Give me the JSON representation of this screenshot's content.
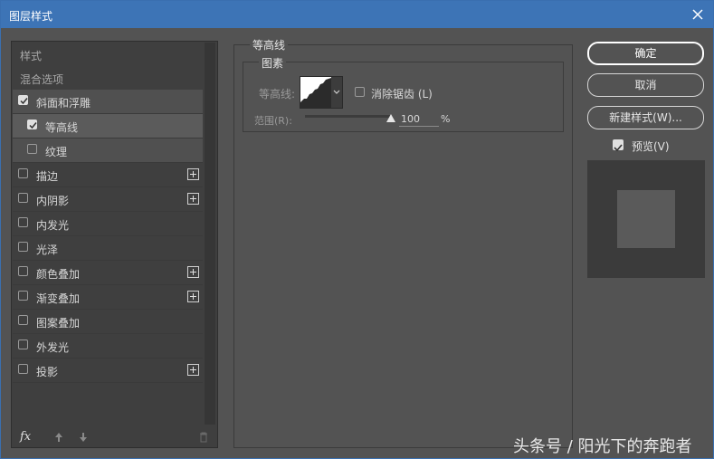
{
  "window": {
    "title": "图层样式",
    "close_icon": "close-icon"
  },
  "left": {
    "items": [
      {
        "label": "样式",
        "type": "header"
      },
      {
        "label": "混合选项",
        "type": "header"
      },
      {
        "label": "斜面和浮雕",
        "checked": true,
        "indent": 0,
        "plus": false
      },
      {
        "label": "等高线",
        "checked": true,
        "indent": 1,
        "plus": false
      },
      {
        "label": "纹理",
        "checked": false,
        "indent": 1,
        "plus": false
      },
      {
        "label": "描边",
        "checked": false,
        "indent": 0,
        "plus": true
      },
      {
        "label": "内阴影",
        "checked": false,
        "indent": 0,
        "plus": true
      },
      {
        "label": "内发光",
        "checked": false,
        "indent": 0,
        "plus": false
      },
      {
        "label": "光泽",
        "checked": false,
        "indent": 0,
        "plus": false
      },
      {
        "label": "颜色叠加",
        "checked": false,
        "indent": 0,
        "plus": true
      },
      {
        "label": "渐变叠加",
        "checked": false,
        "indent": 0,
        "plus": true
      },
      {
        "label": "图案叠加",
        "checked": false,
        "indent": 0,
        "plus": false
      },
      {
        "label": "外发光",
        "checked": false,
        "indent": 0,
        "plus": false
      },
      {
        "label": "投影",
        "checked": false,
        "indent": 0,
        "plus": true
      }
    ],
    "bottom": {
      "fx_label": "fx"
    }
  },
  "main": {
    "group_title": "等高线",
    "sub_title": "图素",
    "contour_label": "等高线:",
    "antialias_label": "消除锯齿 (L)",
    "range_label": "范围(R):",
    "range_value": "100",
    "range_unit": "%"
  },
  "buttons": {
    "ok": "确定",
    "cancel": "取消",
    "new_style": "新建样式(W)...",
    "preview": "预览(V)"
  },
  "watermark": "头条号 / 阳光下的奔跑者"
}
